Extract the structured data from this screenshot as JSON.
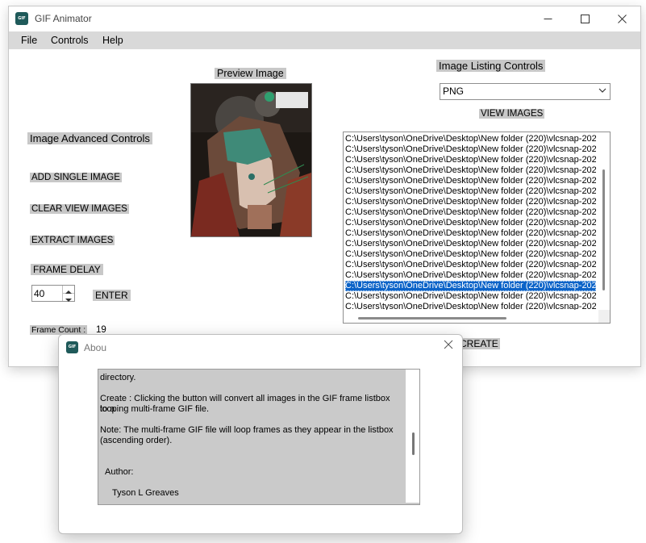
{
  "app": {
    "title": "GIF Animator",
    "icon_text": "GIF"
  },
  "menu": [
    "File",
    "Controls",
    "Help"
  ],
  "labels": {
    "preview": "Preview Image",
    "listing_controls": "Image Listing Controls",
    "advanced_controls": "Image Advanced Controls",
    "frame_delay": "FRAME DELAY",
    "frame_count_label": "Frame Count :",
    "frame_count_value": "19"
  },
  "buttons": {
    "view_images": "VIEW IMAGES",
    "add_single": "ADD SINGLE IMAGE",
    "clear_view": "CLEAR VIEW IMAGES",
    "extract": "EXTRACT IMAGES",
    "enter": "ENTER",
    "create": "CREATE"
  },
  "format_select": {
    "value": "PNG"
  },
  "frame_delay_value": "40",
  "listbox": {
    "selected_index": 14,
    "items": [
      "C:\\Users\\tyson\\OneDrive\\Desktop\\New folder (220)\\vlcsnap-202",
      "C:\\Users\\tyson\\OneDrive\\Desktop\\New folder (220)\\vlcsnap-202",
      "C:\\Users\\tyson\\OneDrive\\Desktop\\New folder (220)\\vlcsnap-202",
      "C:\\Users\\tyson\\OneDrive\\Desktop\\New folder (220)\\vlcsnap-202",
      "C:\\Users\\tyson\\OneDrive\\Desktop\\New folder (220)\\vlcsnap-202",
      "C:\\Users\\tyson\\OneDrive\\Desktop\\New folder (220)\\vlcsnap-202",
      "C:\\Users\\tyson\\OneDrive\\Desktop\\New folder (220)\\vlcsnap-202",
      "C:\\Users\\tyson\\OneDrive\\Desktop\\New folder (220)\\vlcsnap-202",
      "C:\\Users\\tyson\\OneDrive\\Desktop\\New folder (220)\\vlcsnap-202",
      "C:\\Users\\tyson\\OneDrive\\Desktop\\New folder (220)\\vlcsnap-202",
      "C:\\Users\\tyson\\OneDrive\\Desktop\\New folder (220)\\vlcsnap-202",
      "C:\\Users\\tyson\\OneDrive\\Desktop\\New folder (220)\\vlcsnap-202",
      "C:\\Users\\tyson\\OneDrive\\Desktop\\New folder (220)\\vlcsnap-202",
      "C:\\Users\\tyson\\OneDrive\\Desktop\\New folder (220)\\vlcsnap-202",
      "C:\\Users\\tyson\\OneDrive\\Desktop\\New folder (220)\\vlcsnap-202",
      "C:\\Users\\tyson\\OneDrive\\Desktop\\New folder (220)\\vlcsnap-202",
      "C:\\Users\\tyson\\OneDrive\\Desktop\\New folder (220)\\vlcsnap-202"
    ]
  },
  "about": {
    "title": "Abou",
    "lines": [
      "directory.",
      "Create : Clicking the button will convert all images in the GIF frame listbox to a",
      "looping multi-frame GIF file.",
      "Note: The multi-frame GIF file will loop frames as they appear in the listbox",
      "(ascending order).",
      "Author:",
      "Tyson L Greaves"
    ]
  },
  "colors": {
    "menubar": "#d9d9d9",
    "label_bg": "#c8c8c8",
    "selection": "#0b63c8",
    "about_bg": "#cacaca"
  }
}
